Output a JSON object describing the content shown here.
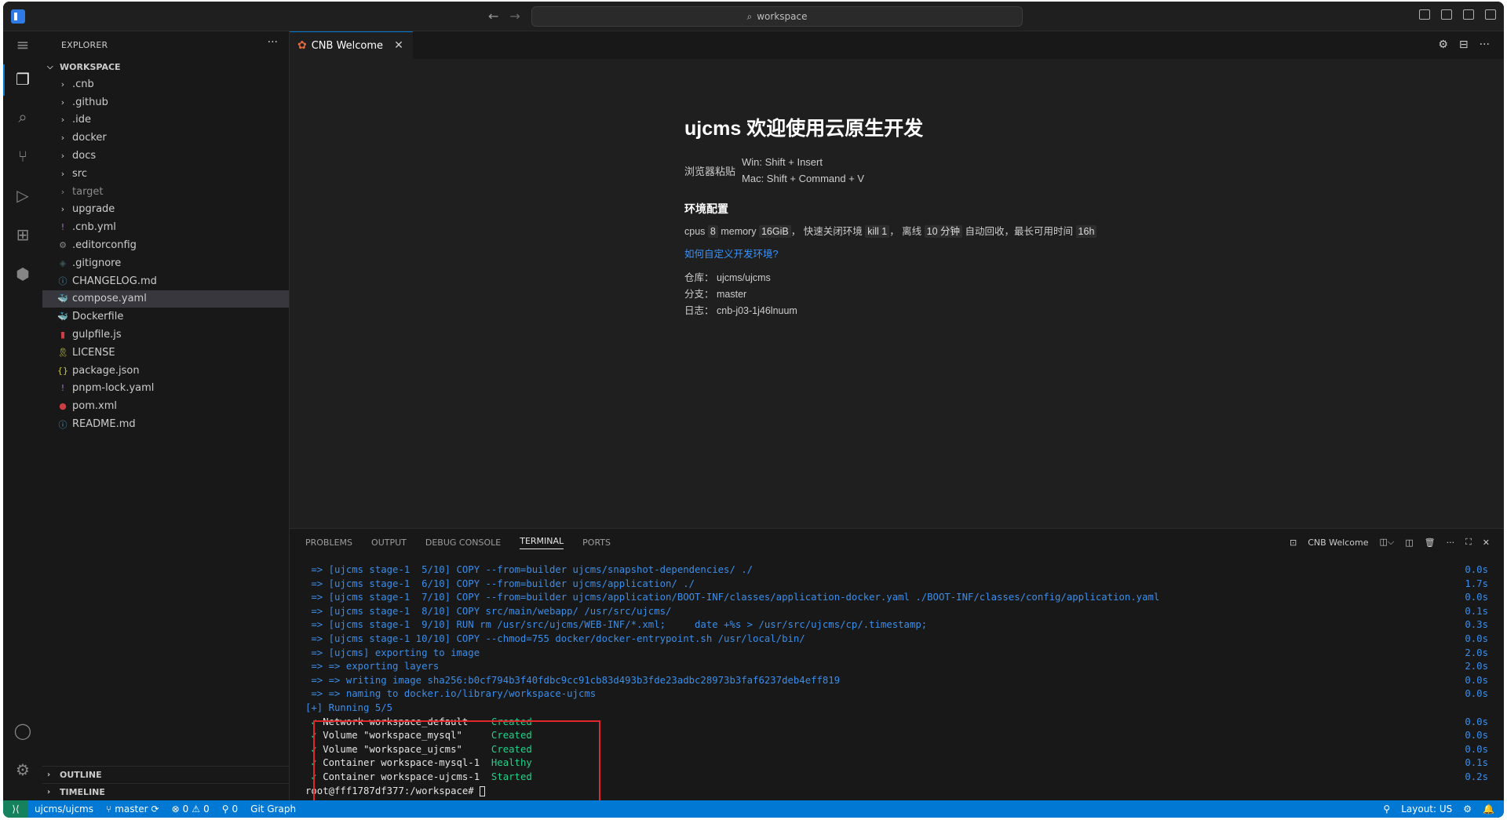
{
  "titlebar": {
    "search_text": "workspace",
    "back_icon": "arrow-left-icon",
    "forward_icon": "arrow-right-icon"
  },
  "activitybar": {
    "items": [
      "explorer-icon",
      "search-icon",
      "source-control-icon",
      "run-debug-icon",
      "extensions-icon",
      "cnb-icon"
    ],
    "bottom": [
      "account-icon",
      "settings-icon"
    ]
  },
  "sidebar": {
    "header": "EXPLORER",
    "more": "···",
    "workspace_title": "WORKSPACE",
    "items": [
      {
        "label": ".cnb",
        "icon": "›",
        "color": "#cccccc",
        "dim": false
      },
      {
        "label": ".github",
        "icon": "›",
        "color": "#cccccc",
        "dim": false
      },
      {
        "label": ".ide",
        "icon": "›",
        "color": "#cccccc",
        "dim": false
      },
      {
        "label": "docker",
        "icon": "›",
        "color": "#cccccc",
        "dim": false
      },
      {
        "label": "docs",
        "icon": "›",
        "color": "#cccccc",
        "dim": false
      },
      {
        "label": "src",
        "icon": "›",
        "color": "#cccccc",
        "dim": false
      },
      {
        "label": "target",
        "icon": "›",
        "color": "#8b8b8b",
        "dim": true
      },
      {
        "label": "upgrade",
        "icon": "›",
        "color": "#cccccc",
        "dim": false
      },
      {
        "label": ".cnb.yml",
        "icon": "!",
        "color": "#a074c4",
        "dim": false
      },
      {
        "label": ".editorconfig",
        "icon": "⚙",
        "color": "#8b8b8b",
        "dim": false
      },
      {
        "label": ".gitignore",
        "icon": "◈",
        "color": "#41535b",
        "dim": false
      },
      {
        "label": "CHANGELOG.md",
        "icon": "ⓘ",
        "color": "#519aba",
        "dim": false
      },
      {
        "label": "compose.yaml",
        "icon": "🐳",
        "color": "#e37933",
        "dim": false
      },
      {
        "label": "Dockerfile",
        "icon": "🐳",
        "color": "#519aba",
        "dim": false
      },
      {
        "label": "gulpfile.js",
        "icon": "▮",
        "color": "#cc3e44",
        "dim": false
      },
      {
        "label": "LICENSE",
        "icon": "🎗",
        "color": "#cbcb41",
        "dim": false
      },
      {
        "label": "package.json",
        "icon": "{}",
        "color": "#cbcb41",
        "dim": false
      },
      {
        "label": "pnpm-lock.yaml",
        "icon": "!",
        "color": "#a074c4",
        "dim": false
      },
      {
        "label": "pom.xml",
        "icon": "●",
        "color": "#cc3e44",
        "dim": false
      },
      {
        "label": "README.md",
        "icon": "ⓘ",
        "color": "#519aba",
        "dim": false
      }
    ],
    "outline": "OUTLINE",
    "timeline": "TIMELINE"
  },
  "editor": {
    "tab_label": "CNB Welcome",
    "tab_close": "✕",
    "welcome": {
      "title": "ujcms 欢迎使用云原生开发",
      "paste_label": "浏览器粘贴",
      "paste_win": "Win: Shift + Insert",
      "paste_mac": "Mac: Shift + Command + V",
      "env_heading": "环境配置",
      "cpus_label": "cpus",
      "cpus_value": "8",
      "memory_label": "memory",
      "memory_value": "16GiB",
      "close_label": "， 快速关闭环境",
      "close_value": "kill 1",
      "offline_label": "， 离线",
      "offline_value": "10 分钟",
      "recycle_label": "自动回收，最长可用时间",
      "max_value": "16h",
      "custom_link": "如何自定义开发环境?",
      "repo_label": "仓库：",
      "repo_value": "ujcms/ujcms",
      "branch_label": "分支：",
      "branch_value": "master",
      "log_label": "日志：",
      "log_value": "cnb-j03-1j46lnuum"
    }
  },
  "panel": {
    "tabs": [
      "PROBLEMS",
      "OUTPUT",
      "DEBUG CONSOLE",
      "TERMINAL",
      "PORTS"
    ],
    "active_tab": "TERMINAL",
    "terminal_name": "CNB Welcome",
    "build_lines": [
      {
        "text": " => [ujcms stage-1  5/10] COPY --from=builder ujcms/snapshot-dependencies/ ./",
        "time": "0.0s"
      },
      {
        "text": " => [ujcms stage-1  6/10] COPY --from=builder ujcms/application/ ./",
        "time": "1.7s"
      },
      {
        "text": " => [ujcms stage-1  7/10] COPY --from=builder ujcms/application/BOOT-INF/classes/application-docker.yaml ./BOOT-INF/classes/config/application.yaml",
        "time": "0.0s"
      },
      {
        "text": " => [ujcms stage-1  8/10] COPY src/main/webapp/ /usr/src/ujcms/",
        "time": "0.1s"
      },
      {
        "text": " => [ujcms stage-1  9/10] RUN rm /usr/src/ujcms/WEB-INF/*.xml;     date +%s > /usr/src/ujcms/cp/.timestamp;",
        "time": "0.3s"
      },
      {
        "text": " => [ujcms stage-1 10/10] COPY --chmod=755 docker/docker-entrypoint.sh /usr/local/bin/",
        "time": "0.0s"
      },
      {
        "text": " => [ujcms] exporting to image",
        "time": "2.0s"
      },
      {
        "text": " => => exporting layers",
        "time": "2.0s"
      },
      {
        "text": " => => writing image sha256:b0cf794b3f40fdbc9cc91cb83d493b3fde23adbc28973b3faf6237deb4eff819",
        "time": "0.0s"
      },
      {
        "text": " => => naming to docker.io/library/workspace-ujcms",
        "time": "0.0s"
      },
      {
        "text": "[+] Running 5/5",
        "time": ""
      }
    ],
    "status_lines": [
      {
        "check": " ✓",
        "name": " Network workspace_default    ",
        "state": "Created",
        "time": "0.0s"
      },
      {
        "check": " ✓",
        "name": " Volume \"workspace_mysql\"     ",
        "state": "Created",
        "time": "0.0s"
      },
      {
        "check": " ✓",
        "name": " Volume \"workspace_ujcms\"     ",
        "state": "Created",
        "time": "0.0s"
      },
      {
        "check": " ✓",
        "name": " Container workspace-mysql-1  ",
        "state": "Healthy",
        "time": "0.1s"
      },
      {
        "check": " ✓",
        "name": " Container workspace-ujcms-1  ",
        "state": "Started",
        "time": "0.2s"
      }
    ],
    "prompt": "root@fff1787df377:/workspace# "
  },
  "statusbar": {
    "repo": "ujcms/ujcms",
    "branch": "master",
    "errors": "0",
    "warnings": "0",
    "ports": "0",
    "git_graph": "Git Graph",
    "layout": "Layout: US"
  },
  "colors": {
    "accent": "#0078d4",
    "remote": "#16825d",
    "highlight": "#e0262b"
  }
}
